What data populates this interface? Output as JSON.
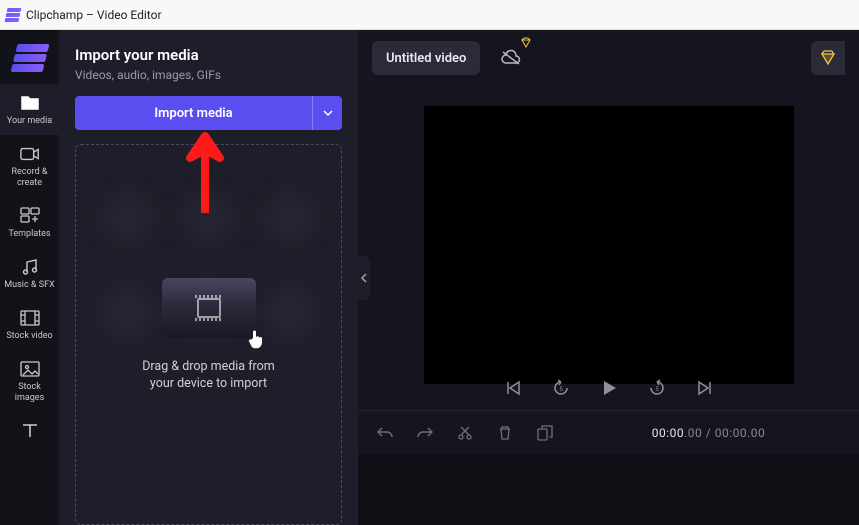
{
  "titlebar": {
    "title": "Clipchamp – Video Editor"
  },
  "rail": {
    "items": [
      {
        "label": "Your media",
        "icon": "folder"
      },
      {
        "label": "Record &\ncreate",
        "icon": "camera"
      },
      {
        "label": "Templates",
        "icon": "grid"
      },
      {
        "label": "Music & SFX",
        "icon": "music"
      },
      {
        "label": "Stock video",
        "icon": "film"
      },
      {
        "label": "Stock\nimages",
        "icon": "image"
      },
      {
        "label": "",
        "icon": "text"
      }
    ]
  },
  "mediapanel": {
    "heading": "Import your media",
    "sub": "Videos, audio, images, GIFs",
    "import_label": "Import media",
    "drop_msg": "Drag & drop media from\nyour device to import"
  },
  "topbar": {
    "title": "Untitled video"
  },
  "time": {
    "current": "00:00",
    "current_frac": ".00",
    "total": "00:00",
    "total_frac": ".00",
    "sep": " / "
  },
  "colors": {
    "accent": "#5b4ef0",
    "highlight_arrow": "#ff1a1a",
    "premium_gem": "#f5c542"
  }
}
